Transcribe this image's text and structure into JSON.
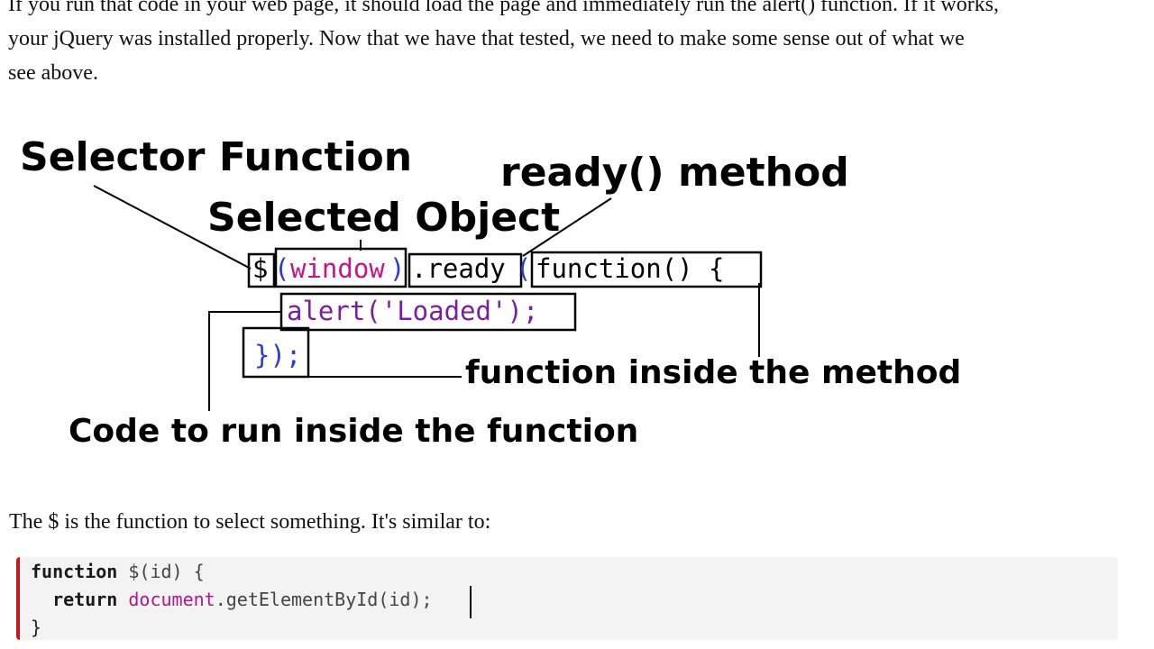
{
  "intro": {
    "line1": "If you run that code in your web page, it should load the page and immediately run the alert() function. If it works,",
    "line2": "your jQuery was installed properly. Now that we have that tested, we need to make some sense out of what we",
    "line3": "see above."
  },
  "diagram": {
    "labels": {
      "selector_function": "Selector Function",
      "selected_object": "Selected Object",
      "ready_method": "ready() method",
      "function_inside": "function inside the method",
      "code_to_run": "Code to run inside the function"
    },
    "code": {
      "dollar": "$",
      "paren_open": "(",
      "window": "window",
      "paren_close": ")",
      "ready": ".ready",
      "ready_paren": "(",
      "function_decl": "function() {",
      "alert_line": "alert('Loaded');",
      "closing": "});"
    },
    "colors": {
      "window_token": "#c71585",
      "paren_token": "#2b3bd4",
      "keyword_token": "#000000",
      "string_token": "#7a1fa2"
    }
  },
  "para": "The $ is the function to select something. It's similar to:",
  "codeblock": {
    "line1_kw": "function",
    "line1_rest": " $(id) {",
    "line2_indent": "  ",
    "line2_kw": "return",
    "line2_obj": "document",
    "line2_rest": ".getElementById(id);",
    "line3": "}",
    "accent_color": "#c41a1a"
  }
}
